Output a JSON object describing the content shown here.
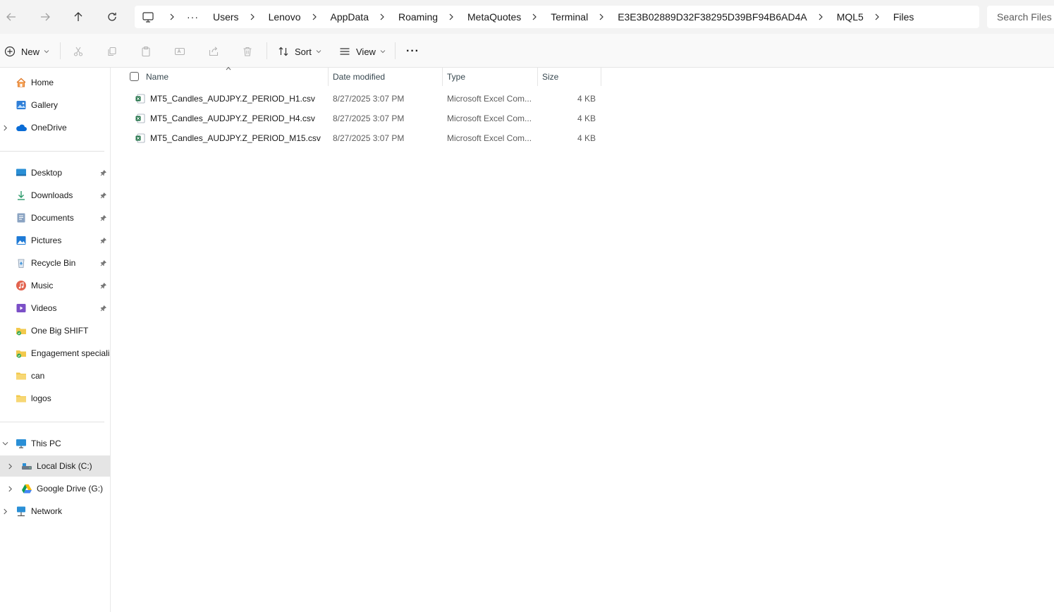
{
  "address_bar": {
    "crumbs": [
      "Users",
      "Lenovo",
      "AppData",
      "Roaming",
      "MetaQuotes",
      "Terminal",
      "E3E3B02889D32F38295D39BF94B6AD4A",
      "MQL5",
      "Files"
    ],
    "more": "···",
    "search_placeholder": "Search Files"
  },
  "command_bar": {
    "new_label": "New",
    "sort_label": "Sort",
    "view_label": "View",
    "more": "···"
  },
  "sidebar": {
    "home": "Home",
    "gallery": "Gallery",
    "onedrive": "OneDrive",
    "desktop": "Desktop",
    "downloads": "Downloads",
    "documents": "Documents",
    "pictures": "Pictures",
    "recycle_bin": "Recycle Bin",
    "music": "Music",
    "videos": "Videos",
    "one_big_shift": "One Big SHIFT",
    "engagement": "Engagement specialis",
    "can": "can",
    "logos": "logos",
    "this_pc": "This PC",
    "local_disk": "Local Disk (C:)",
    "google_drive": "Google Drive (G:)",
    "network": "Network"
  },
  "columns": {
    "name": "Name",
    "date": "Date modified",
    "type": "Type",
    "size": "Size"
  },
  "files": [
    {
      "name": "MT5_Candles_AUDJPY.Z_PERIOD_H1.csv",
      "date": "8/27/2025 3:07 PM",
      "type": "Microsoft Excel Com...",
      "size": "4 KB"
    },
    {
      "name": "MT5_Candles_AUDJPY.Z_PERIOD_H4.csv",
      "date": "8/27/2025 3:07 PM",
      "type": "Microsoft Excel Com...",
      "size": "4 KB"
    },
    {
      "name": "MT5_Candles_AUDJPY.Z_PERIOD_M15.csv",
      "date": "8/27/2025 3:07 PM",
      "type": "Microsoft Excel Com...",
      "size": "4 KB"
    }
  ],
  "colors": {
    "selected_bg": "#e5e5e5",
    "folder_yellow": "#f2c94c",
    "excel_green": "#1d7044",
    "accent_blue": "#0067c0"
  }
}
